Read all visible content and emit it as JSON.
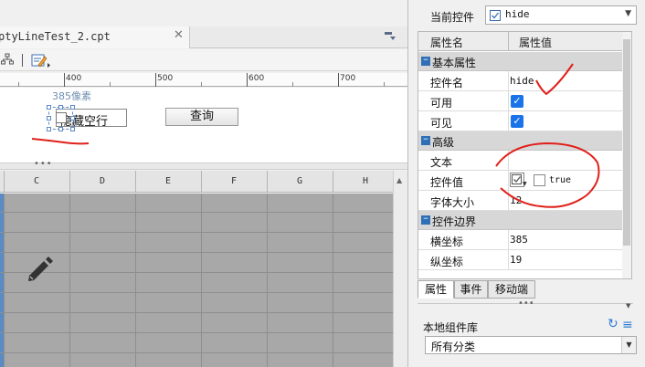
{
  "editor": {
    "tab_title": "ptyLineTest_2.cpt",
    "ruler_labels": [
      "400",
      "500",
      "600",
      "700"
    ],
    "position_hint": "385像素",
    "checkbox_label": "隐藏空行",
    "query_button": "查询",
    "grid_columns": [
      "C",
      "D",
      "E",
      "F",
      "G",
      "H"
    ]
  },
  "properties": {
    "current_label": "当前控件",
    "current_value": "hide",
    "header_name": "属性名",
    "header_value": "属性值",
    "categories": [
      "基本属性",
      "高级",
      "控件边界"
    ],
    "rows": {
      "control_name": {
        "name": "控件名",
        "value": "hide"
      },
      "enabled": {
        "name": "可用",
        "checked": true
      },
      "visible": {
        "name": "可见",
        "checked": true
      },
      "text": {
        "name": "文本",
        "value": ""
      },
      "control_value": {
        "name": "控件值",
        "value": "true"
      },
      "font_size": {
        "name": "字体大小",
        "value": "12"
      },
      "x": {
        "name": "横坐标",
        "value": "385"
      },
      "y": {
        "name": "纵坐标",
        "value": "19"
      }
    },
    "tabs": [
      "属性",
      "事件",
      "移动端"
    ]
  },
  "library": {
    "title": "本地组件库",
    "select_value": "所有分类"
  },
  "annotations": {
    "stroke_color": "#e0201a"
  },
  "colors": {
    "accent": "#1a73e8",
    "selection": "#5b8bc5",
    "category_toggle": "#2f6fb5"
  }
}
